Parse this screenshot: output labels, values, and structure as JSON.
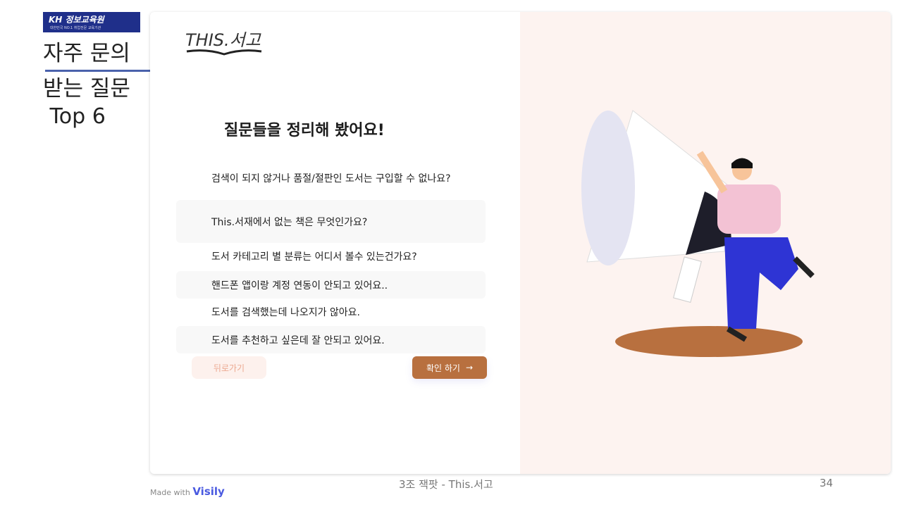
{
  "logo": {
    "name": "KH 정보교육원",
    "tagline": "대한민국 NO.1 취업전문 교육기관"
  },
  "sidebar_title": [
    "자주 문의",
    "받는 질문",
    " Top 6"
  ],
  "brand": "THIS.서고",
  "heading": "질문들을 정리해 봤어요!",
  "questions": [
    "검색이 되지 않거나 품절/절판인 도서는 구입할 수 없나요?",
    "This.서재에서 없는 책은 무엇인가요?",
    "도서 카테고리 별 분류는 어디서 볼수 있는건가요?",
    "핸드폰 앱이랑 계정 연동이 안되고 있어요..",
    "도서를 검색했는데 나오지가 않아요.",
    "도서를 추천하고 싶은데 잘 안되고 있어요."
  ],
  "buttons": {
    "back": "뒤로가기",
    "confirm": "확인 하기",
    "confirm_icon": "arrow-right-icon"
  },
  "footer": {
    "center": "3조 잭팟 - This.서고",
    "page": "34",
    "made_with": "Made with",
    "made_brand": "Visily"
  },
  "colors": {
    "accent": "#b8703f",
    "panel": "#fdf3f0",
    "rule": "#4a62ac"
  }
}
